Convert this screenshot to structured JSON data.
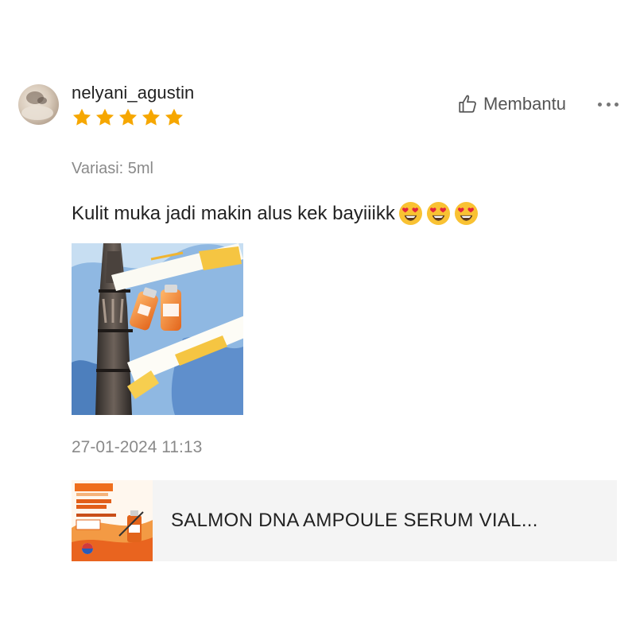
{
  "review": {
    "username": "nelyani_agustin",
    "rating": 5,
    "helpful_label": "Membantu",
    "variant": "Variasi: 5ml",
    "comment": "Kulit muka jadi makin alus kek bayiiikk",
    "comment_emojis": [
      "heart-eyes-emoji",
      "heart-eyes-emoji",
      "heart-eyes-emoji"
    ],
    "timestamp": "27-01-2024 11:13"
  },
  "product": {
    "name": "SALMON DNA AMPOULE SERUM VIAL..."
  },
  "colors": {
    "star": "#f6a700",
    "text_primary": "#222222",
    "text_secondary": "#8a8a8a",
    "product_card_bg": "#f4f4f4"
  }
}
